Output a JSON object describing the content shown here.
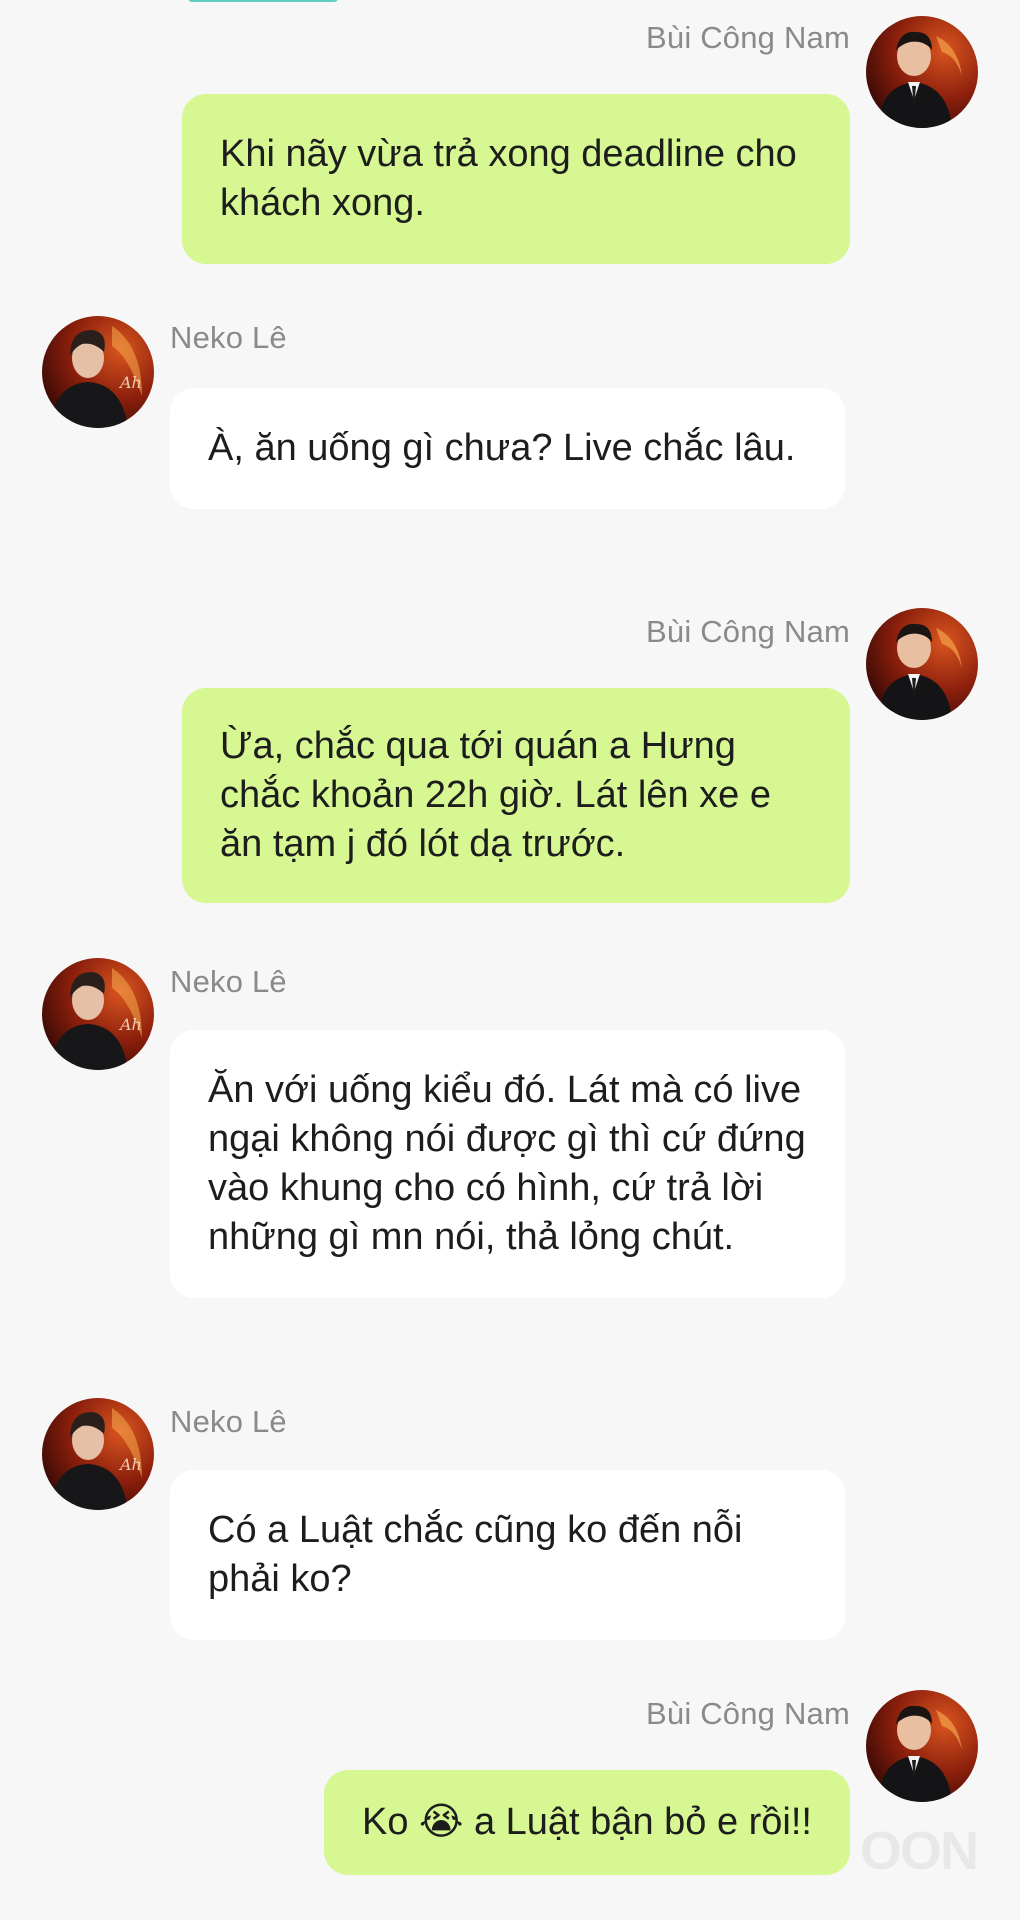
{
  "chat": {
    "messages": [
      {
        "sender": "Bùi Công Nam",
        "side": "right",
        "text": "Khi nãy vừa trả xong deadline cho khách xong."
      },
      {
        "sender": "Neko Lê",
        "side": "left",
        "text": "À, ăn uống gì chưa? Live chắc lâu."
      },
      {
        "sender": "Bùi Công Nam",
        "side": "right",
        "text": "Ừa, chắc qua tới quán a Hưng chắc khoản 22h giờ. Lát lên xe e ăn tạm j đó lót dạ trước."
      },
      {
        "sender": "Neko Lê",
        "side": "left",
        "text": "Ăn với uống kiểu đó. Lát mà có live ngại không nói được gì thì cứ đứng vào khung cho có hình, cứ trả lời những gì mn nói, thả lỏng chút."
      },
      {
        "sender": "Neko Lê",
        "side": "left",
        "text": "Có a Luật chắc cũng ko đến nỗi phải ko?"
      },
      {
        "sender": "Bùi Công Nam",
        "side": "right",
        "text": "Ko 😭 a Luật bận bỏ e rồi!!"
      }
    ]
  },
  "watermark": "OON",
  "colors": {
    "outgoing_bubble": "#d6f791",
    "incoming_bubble": "#ffffff",
    "background": "#f7f7f8",
    "sender_name": "#8a8a8a"
  }
}
